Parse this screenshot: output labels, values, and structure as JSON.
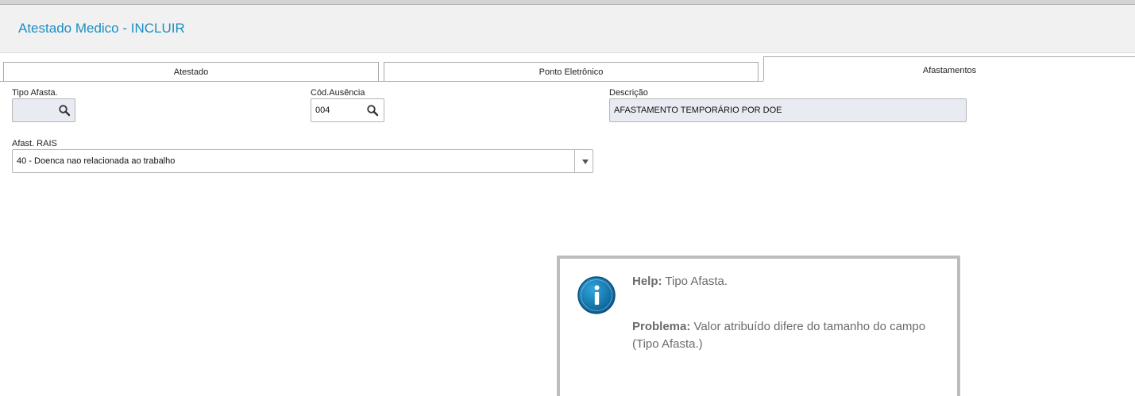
{
  "header": {
    "title": "Atestado Medico - INCLUIR"
  },
  "tabs": [
    {
      "label": "Atestado",
      "active": false
    },
    {
      "label": "Ponto Eletrônico",
      "active": false
    },
    {
      "label": "Afastamentos",
      "active": true
    }
  ],
  "form": {
    "tipo_afasta": {
      "label": "Tipo Afasta.",
      "value": "",
      "icon": "search-icon"
    },
    "cod_ausencia": {
      "label": "Cód.Ausência",
      "value": "004",
      "icon": "search-icon"
    },
    "descricao": {
      "label": "Descrição",
      "value": "AFASTAMENTO TEMPORÁRIO POR DOE"
    },
    "afast_rais": {
      "label": "Afast. RAIS",
      "selected": "40 - Doenca nao relacionada ao trabalho",
      "icon": "chevron-down-icon"
    }
  },
  "help": {
    "icon": "info-icon",
    "help_label": "Help:",
    "help_text": "Tipo Afasta.",
    "problem_label": "Problema:",
    "problem_text_line1": "Valor atribuído difere do tamanho do campo",
    "problem_text_line2": "(Tipo Afasta.)"
  },
  "colors": {
    "accent": "#1a8fc2",
    "readonly_field_bg": "#e8ebf2",
    "dialog_border": "#bdbdbd",
    "help_text": "#6b6b6b"
  }
}
